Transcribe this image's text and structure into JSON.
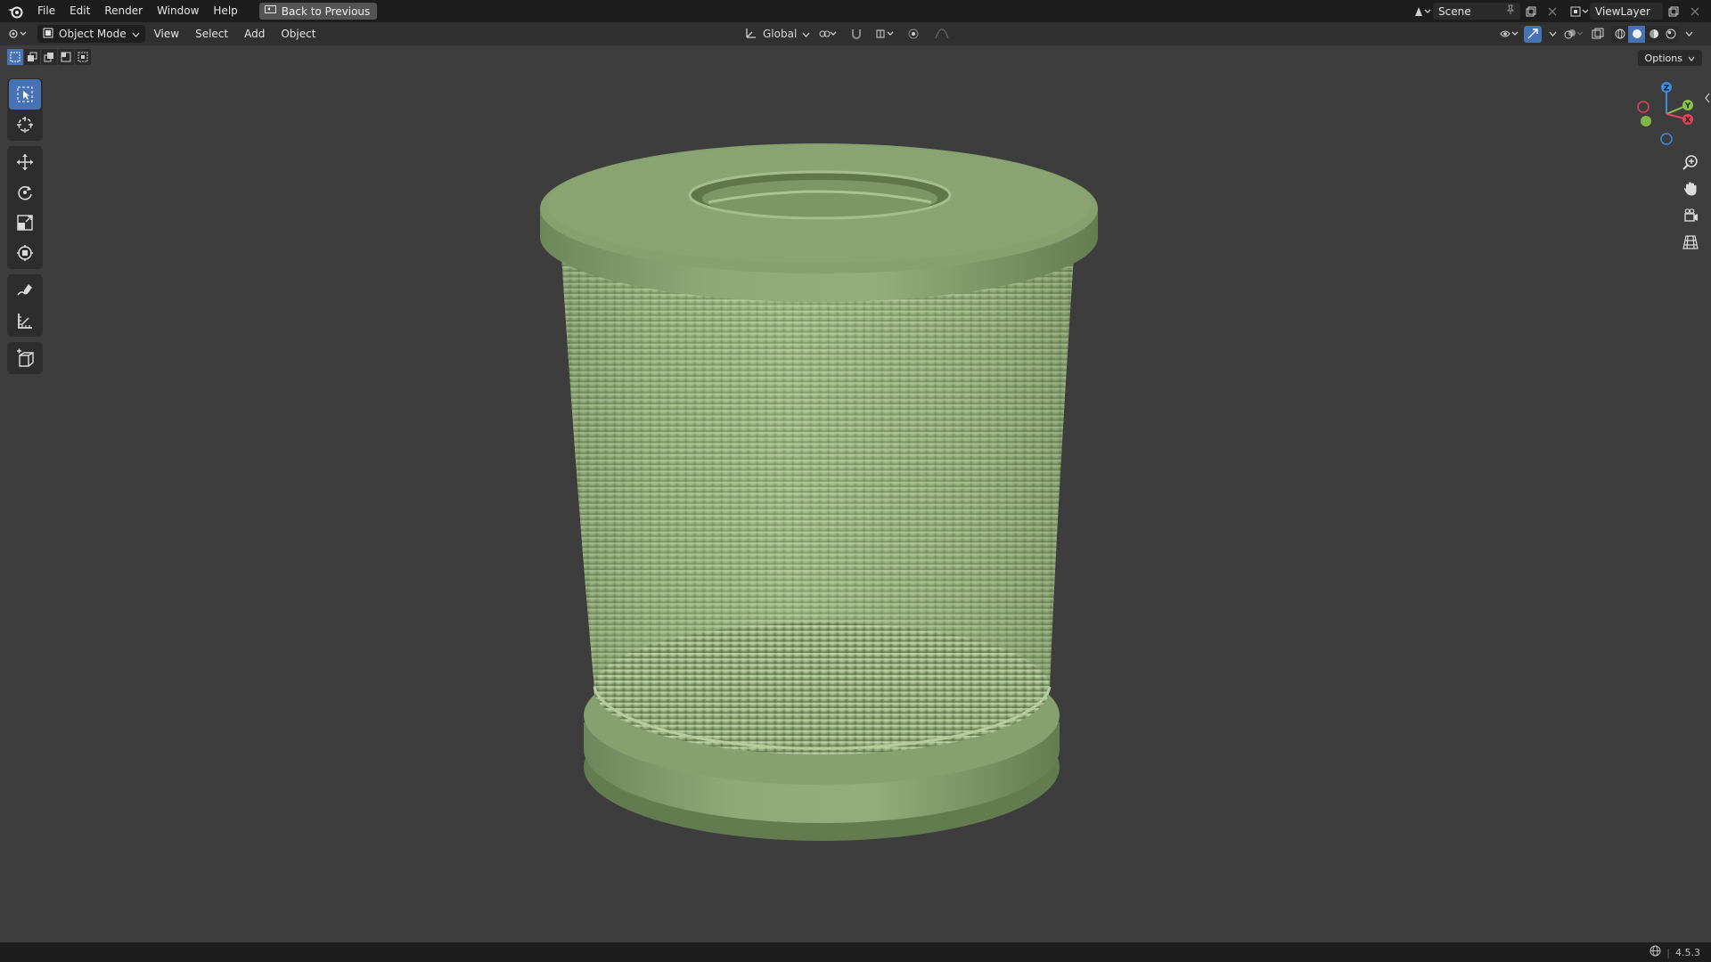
{
  "menubar": {
    "items": [
      "File",
      "Edit",
      "Render",
      "Window",
      "Help"
    ],
    "back_button": "Back to Previous",
    "scene": "Scene",
    "view_layer": "ViewLayer"
  },
  "header": {
    "mode": "Object Mode",
    "menus": [
      "View",
      "Select",
      "Add",
      "Object"
    ],
    "transform_orientation": "Global",
    "options_label": "Options"
  },
  "toolbar": {
    "tools": [
      "select-box",
      "cursor",
      "move",
      "rotate",
      "scale",
      "transform",
      "annotate",
      "measure",
      "add-cube"
    ],
    "active_tool": "select-box"
  },
  "gizmo": {
    "axes": [
      "X",
      "Y",
      "Z"
    ]
  },
  "viewport": {
    "object": "wire spool",
    "object_color": "#7c9866",
    "background_color": "#3d3d3d"
  },
  "status": {
    "version": "4.5.3"
  },
  "colors": {
    "accent": "#4772b3",
    "x_axis": "#e0435a",
    "y_axis": "#8bc34a",
    "z_axis": "#3d8ce0"
  }
}
